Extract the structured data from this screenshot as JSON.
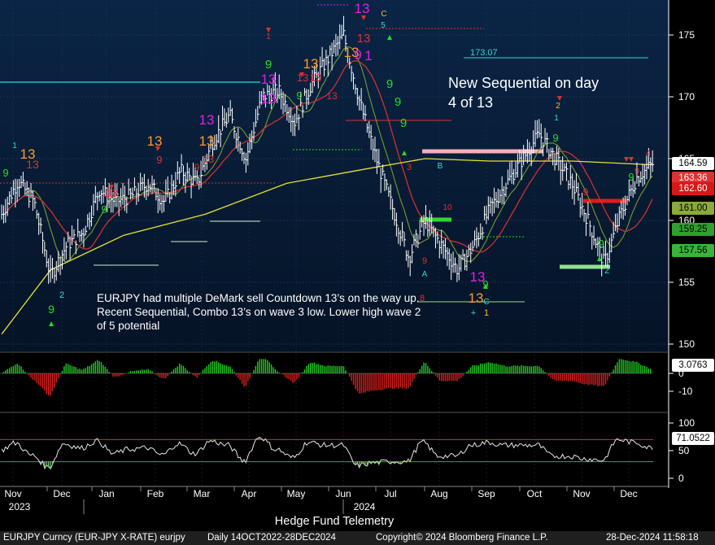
{
  "chart_data": {
    "type": "line",
    "instrument": "EURJPY Curncy (EUR-JPY X-RATE) eurjpy",
    "period": "Daily 14OCT2022-28DEC2024",
    "months": [
      "Nov",
      "Dec",
      "Jan",
      "Feb",
      "Mar",
      "Apr",
      "May",
      "Jun",
      "Jul",
      "Aug",
      "Sep",
      "Oct",
      "Nov",
      "Dec"
    ],
    "years": [
      "2023",
      "2024"
    ],
    "price_axis": {
      "ticks": [
        150,
        155,
        160,
        165,
        170,
        175
      ],
      "ylim": [
        149.3,
        177.6
      ]
    },
    "osc1_axis": {
      "ticks": [
        "0",
        "-10"
      ]
    },
    "osc2_axis": {
      "ticks": [
        "0",
        "50",
        "100"
      ],
      "ylim": [
        -5,
        105
      ]
    },
    "price_series": {
      "name": "EURJPY",
      "x": [
        0,
        20,
        40,
        60,
        80,
        100,
        120,
        140,
        160,
        180,
        200,
        220,
        240,
        260,
        280,
        300,
        320,
        340,
        360,
        380,
        400,
        420,
        440,
        460,
        480,
        500,
        520,
        540,
        560,
        580,
        600,
        620,
        640,
        660,
        680,
        700,
        720,
        740,
        760,
        780,
        800
      ],
      "values": [
        160.5,
        163.2,
        161.5,
        155.5,
        158.0,
        159.0,
        162.5,
        161.5,
        162.0,
        163.0,
        161.5,
        164.0,
        163.0,
        166.5,
        168.5,
        165.0,
        170.0,
        170.5,
        168.0,
        171.0,
        173.0,
        175.0,
        169.5,
        165.0,
        161.0,
        157.0,
        160.0,
        158.0,
        156.0,
        158.0,
        161.0,
        163.0,
        165.0,
        167.0,
        165.0,
        163.0,
        160.0,
        156.5,
        160.5,
        163.5,
        164.6
      ]
    },
    "price_tags": [
      {
        "label": "164.59",
        "price": 164.59,
        "bg": "#ffffff",
        "fg": "#000000"
      },
      {
        "label": "163.36",
        "price": 163.36,
        "bg": "#e03030",
        "fg": "#ffffff"
      },
      {
        "label": "162.60",
        "price": 162.6,
        "bg": "#d81818",
        "fg": "#ffffff"
      },
      {
        "label": "161.00",
        "price": 161.0,
        "bg": "#8aaa3a",
        "fg": "#000000"
      },
      {
        "label": "159.25",
        "price": 159.25,
        "bg": "#2fa02f",
        "fg": "#000000"
      },
      {
        "label": "157.56",
        "price": 157.56,
        "bg": "#38b538",
        "fg": "#000000"
      }
    ],
    "osc1_tag": {
      "label": "3.0763",
      "bg": "#ffffff",
      "fg": "#000000"
    },
    "osc2_tag": {
      "label": "71.0522",
      "bg": "#ffffff",
      "fg": "#000000"
    },
    "level_label": "173.07",
    "sequential_numbers": [
      "1",
      "13",
      "9",
      "13",
      "13",
      "13",
      "13",
      "13",
      "13",
      "13",
      "13",
      "13",
      "9",
      "2",
      "9",
      "9",
      "13",
      "13",
      "9",
      "9",
      "9",
      "9",
      "1",
      "8",
      "9",
      "2",
      "13",
      "C",
      "5",
      "A",
      "B",
      "C",
      "1",
      "2",
      "3",
      "4"
    ],
    "colors": {
      "price": "#ffffff",
      "ma_yellow": "#e8e030",
      "ma_red": "#d03030",
      "ma_green": "#7a9a2a",
      "sell_setup": "#e03030",
      "buy_setup": "#22dd22",
      "countdown_orange": "#ff9a2a",
      "countdown_magenta": "#e020e0",
      "cyan": "#30d8d8",
      "background_top": "#0a2240",
      "background_bottom": "#041022"
    }
  },
  "annotations": {
    "main_note": "EURJPY had multiple DeMark sell Countdown 13’s on the way up.  Recent Sequential, Combo 13’s on wave 3 low. Lower high wave 2 of 5 potential",
    "new_note": "New Sequential on day 4 of 13"
  },
  "branding": "Hedge Fund Telemetry",
  "footer": {
    "instrument": "EURJPY Curncy (EUR-JPY X-RATE) eurjpy",
    "period": "Daily 14OCT2022-28DEC2024",
    "copyright": "Copyright© 2024 Bloomberg Finance L.P.",
    "timestamp": "28-Dec-2024 11:58:18"
  }
}
